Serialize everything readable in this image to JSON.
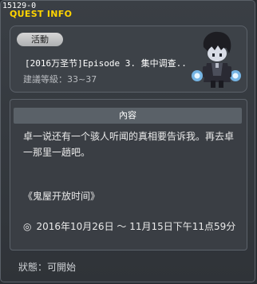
{
  "window": {
    "quest_id": "15129-0",
    "title": "QUEST INFO"
  },
  "quest": {
    "category": "活動",
    "title": "[2016万圣节]Episode 3. 集中调查..",
    "level": "建議等級：33~37",
    "npc_icon": "vampire-npc-icon"
  },
  "content": {
    "header": "內容",
    "body": "卓一说还有一个骇人听闻的真相要告诉我。再去卓一那里一趟吧。",
    "event_title": "《鬼屋开放时间》",
    "period_icon": "clock-icon",
    "period": "2016年10月26日 ～ 11月15日下午11点59分"
  },
  "status": {
    "text": "狀態：可開始"
  },
  "colors": {
    "title": "#ffd400",
    "background": "#2f3338",
    "panel": "#3d4248"
  }
}
